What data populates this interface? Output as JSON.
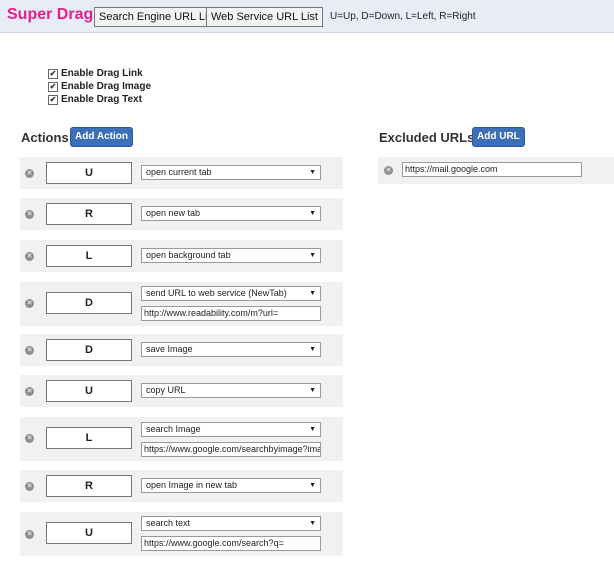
{
  "header": {
    "brand": "Super Drag",
    "search_engine_button": "Search Engine URL List",
    "web_service_button": "Web Service URL List",
    "legend": "U=Up, D=Down, L=Left, R=Right"
  },
  "options": [
    {
      "label": "Enable Drag Link",
      "checked": true
    },
    {
      "label": "Enable Drag Image",
      "checked": true
    },
    {
      "label": "Enable Drag Text",
      "checked": true
    }
  ],
  "actions": {
    "title": "Actions",
    "add_label": "Add Action",
    "rows": [
      {
        "direction": "U",
        "action": "open current tab",
        "url": ""
      },
      {
        "direction": "R",
        "action": "open new tab",
        "url": ""
      },
      {
        "direction": "L",
        "action": "open background tab",
        "url": ""
      },
      {
        "direction": "D",
        "action": "send URL to web service (NewTab)",
        "url": "http://www.readability.com/m?url="
      },
      {
        "direction": "D",
        "action": "save Image",
        "url": ""
      },
      {
        "direction": "U",
        "action": "copy URL",
        "url": ""
      },
      {
        "direction": "L",
        "action": "search Image",
        "url": "https://www.google.com/searchbyimage?image_url="
      },
      {
        "direction": "R",
        "action": "open Image in new tab",
        "url": ""
      },
      {
        "direction": "U",
        "action": "search text",
        "url": "https://www.google.com/search?q="
      }
    ]
  },
  "excluded": {
    "title": "Excluded URLs",
    "add_label": "Add URL",
    "urls": [
      "https://mail.google.com"
    ]
  },
  "icons": {
    "delete": "remove-circle-icon",
    "check": "checkmark-icon",
    "caret": "chevron-down-icon"
  }
}
